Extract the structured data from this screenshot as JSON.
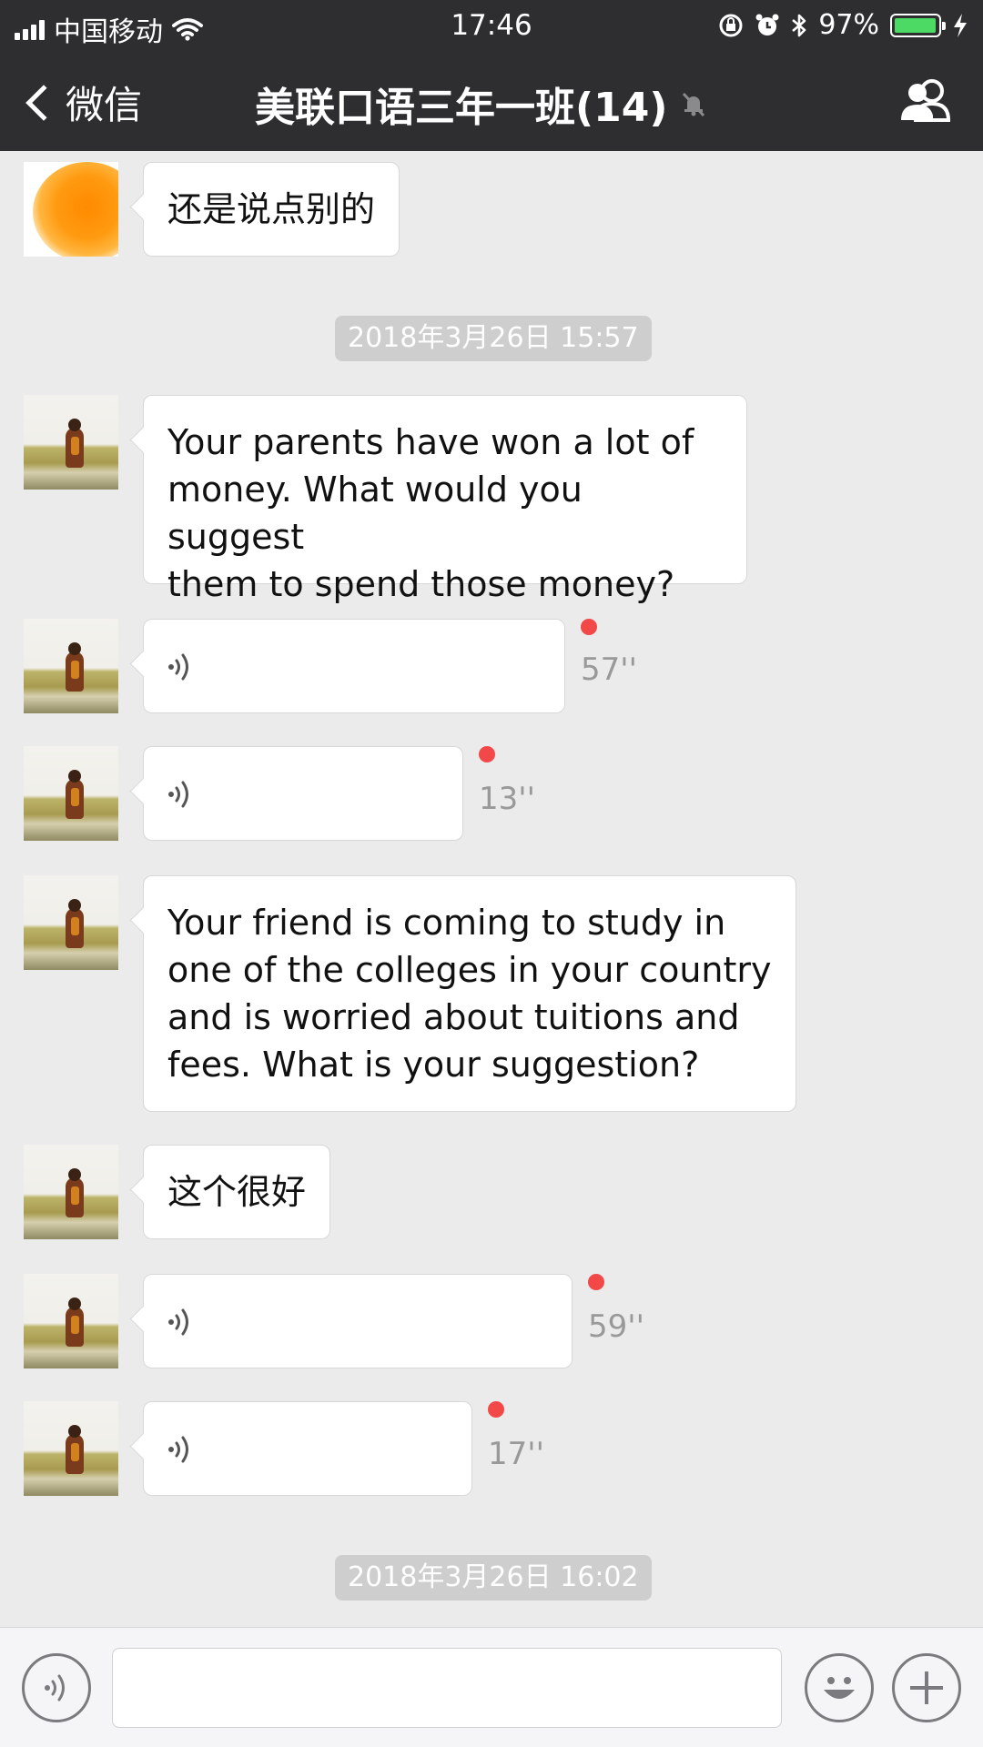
{
  "status_bar": {
    "carrier": "中国移动",
    "time": "17:46",
    "battery": "97%",
    "battery_level": 0.97,
    "icons": [
      "signal-bars-icon",
      "wifi-icon",
      "rotation-lock-icon",
      "alarm-icon",
      "bluetooth-icon",
      "battery-icon",
      "charging-bolt-icon"
    ]
  },
  "nav": {
    "back_label": "微信",
    "title": "美联口语三年一班(14)",
    "muted_icon": "mute-bell-icon",
    "members_icon": "group-members-icon"
  },
  "messages": [
    {
      "type": "text",
      "text": "还是说点别的",
      "avatar": "blurred"
    },
    {
      "type": "timestamp",
      "text": "2018年3月26日 15:57"
    },
    {
      "type": "text",
      "text_lines": [
        "Your parents have won a lot of",
        "money. What would you suggest",
        "them to spend those money?"
      ]
    },
    {
      "type": "voice",
      "duration": "57''",
      "unread": true
    },
    {
      "type": "voice",
      "duration": "13''",
      "unread": true
    },
    {
      "type": "text",
      "text_lines": [
        "Your friend is coming to study in",
        "one of the colleges in your country",
        "and is worried about tuitions and",
        "fees. What is your suggestion?"
      ]
    },
    {
      "type": "text",
      "text": "这个很好"
    },
    {
      "type": "voice",
      "duration": "59''",
      "unread": true
    },
    {
      "type": "voice",
      "duration": "17''",
      "unread": true
    },
    {
      "type": "timestamp",
      "text": "2018年3月26日 16:02"
    }
  ],
  "input_bar": {
    "voice_icon": "voice-input-icon",
    "message_value": "",
    "emoji_icon": "emoji-icon",
    "more_icon": "plus-icon"
  },
  "colors": {
    "nav_background": "#2e2e30",
    "chat_background": "#ebebeb",
    "unread_dot": "#f24848",
    "battery_green": "#4cd964",
    "timestamp_background": "#cecece"
  }
}
